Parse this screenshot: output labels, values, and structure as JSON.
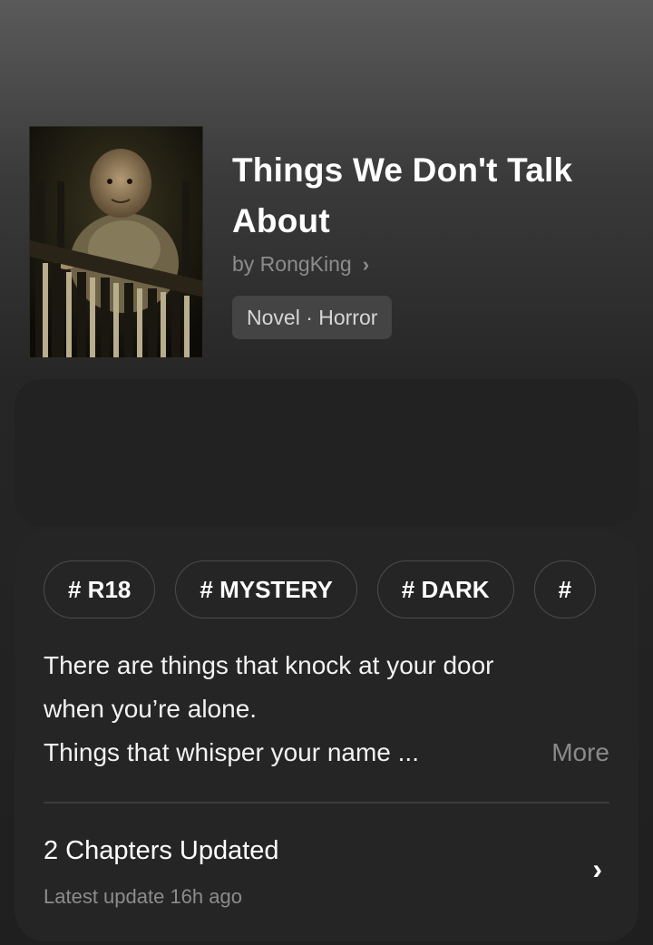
{
  "book": {
    "title": "Things We Don't Talk About",
    "author": "by RongKing",
    "genre": "Novel · Horror"
  },
  "tags": [
    "# R18",
    "# MYSTERY",
    "# DARK",
    "#"
  ],
  "description": {
    "lines": [
      "There are things that knock at your door",
      "when you’re alone.",
      "Things that whisper your name ..."
    ],
    "more_label": "More"
  },
  "chapters": {
    "title": "2 Chapters Updated",
    "subtitle": "Latest update 16h ago"
  },
  "icons": {
    "author_chevron": "chevron-right-icon",
    "chapters_chevron": "chevron-right-icon"
  }
}
